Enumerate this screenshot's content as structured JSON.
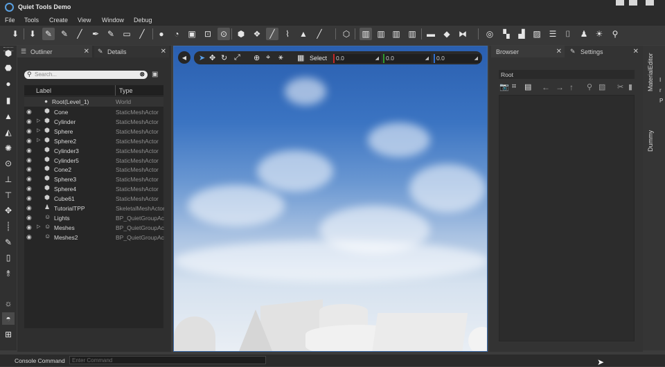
{
  "app": {
    "title": "Quiet Tools Demo"
  },
  "menu": [
    "File",
    "Tools",
    "Create",
    "View",
    "Window",
    "Debug"
  ],
  "toolbar_icons": [
    "spawn-icon",
    "import-icon",
    "brush-icon",
    "paint-icon",
    "pencil-icon",
    "pen-icon",
    "marker-icon",
    "eraser-icon",
    "eyedropper-icon",
    "sphere-tool-icon",
    "rotate-tool-icon",
    "select-box-icon",
    "move-tool-icon",
    "mesh-tool-icon",
    "group-icon",
    "sculpt-icon",
    "smooth-icon",
    "flatten-icon",
    "fill-icon",
    "knife-icon",
    "layers-icon",
    "align-left-icon",
    "align-center-icon",
    "align-right-icon",
    "align-distribute-icon",
    "ruler-icon",
    "snap-icon",
    "mirror-icon",
    "pivot-icon",
    "grid-icon",
    "scale-icon",
    "frame-icon",
    "list-icon",
    "text-icon",
    "figure-icon",
    "light-icon",
    "zoom-icon"
  ],
  "left_panel": {
    "tabs": {
      "outliner": "Outliner",
      "details": "Details"
    },
    "search": {
      "placeholder": "Search..."
    },
    "columns": {
      "label": "Label",
      "type": "Type"
    },
    "root": {
      "label": "Root(Level_1)",
      "type": "World"
    },
    "rows": [
      {
        "label": "Cone",
        "type": "StaticMeshActor",
        "expand": false,
        "icon": "mesh"
      },
      {
        "label": "Cylinder",
        "type": "StaticMeshActor",
        "expand": true,
        "icon": "mesh"
      },
      {
        "label": "Sphere",
        "type": "StaticMeshActor",
        "expand": true,
        "icon": "mesh"
      },
      {
        "label": "Sphere2",
        "type": "StaticMeshActor",
        "expand": true,
        "icon": "mesh"
      },
      {
        "label": "Cylinder3",
        "type": "StaticMeshActor",
        "expand": false,
        "icon": "mesh"
      },
      {
        "label": "Cylinder5",
        "type": "StaticMeshActor",
        "expand": false,
        "icon": "mesh"
      },
      {
        "label": "Cone2",
        "type": "StaticMeshActor",
        "expand": false,
        "icon": "mesh"
      },
      {
        "label": "Sphere3",
        "type": "StaticMeshActor",
        "expand": false,
        "icon": "mesh"
      },
      {
        "label": "Sphere4",
        "type": "StaticMeshActor",
        "expand": false,
        "icon": "mesh"
      },
      {
        "label": "Cube61",
        "type": "StaticMeshActor",
        "expand": false,
        "icon": "mesh"
      },
      {
        "label": "TutorialTPP",
        "type": "SkeletalMeshActor",
        "expand": false,
        "icon": "skeleton"
      },
      {
        "label": "Lights",
        "type": "BP_QuietGroupActor",
        "expand": false,
        "icon": "group"
      },
      {
        "label": "Meshes",
        "type": "BP_QuietGroupActor",
        "expand": true,
        "icon": "group"
      },
      {
        "label": "Meshes2",
        "type": "BP_QuietGroupActor",
        "expand": false,
        "icon": "group"
      }
    ]
  },
  "viewport": {
    "select_label": "Select",
    "coords": {
      "x": "0.0",
      "y": "0.0",
      "z": "0.0"
    },
    "colors": {
      "x": "#c62828",
      "y": "#2e9b2e",
      "z": "#2f6fd0"
    }
  },
  "right_panel": {
    "tabs": {
      "browser": "Browser",
      "settings": "Settings"
    },
    "path": "Root"
  },
  "side_tabs": {
    "material_editor": "MaterialEditor",
    "dummy": "Dummy"
  },
  "status": {
    "console_label": "Console Command",
    "console_placeholder": "Enter Command"
  }
}
